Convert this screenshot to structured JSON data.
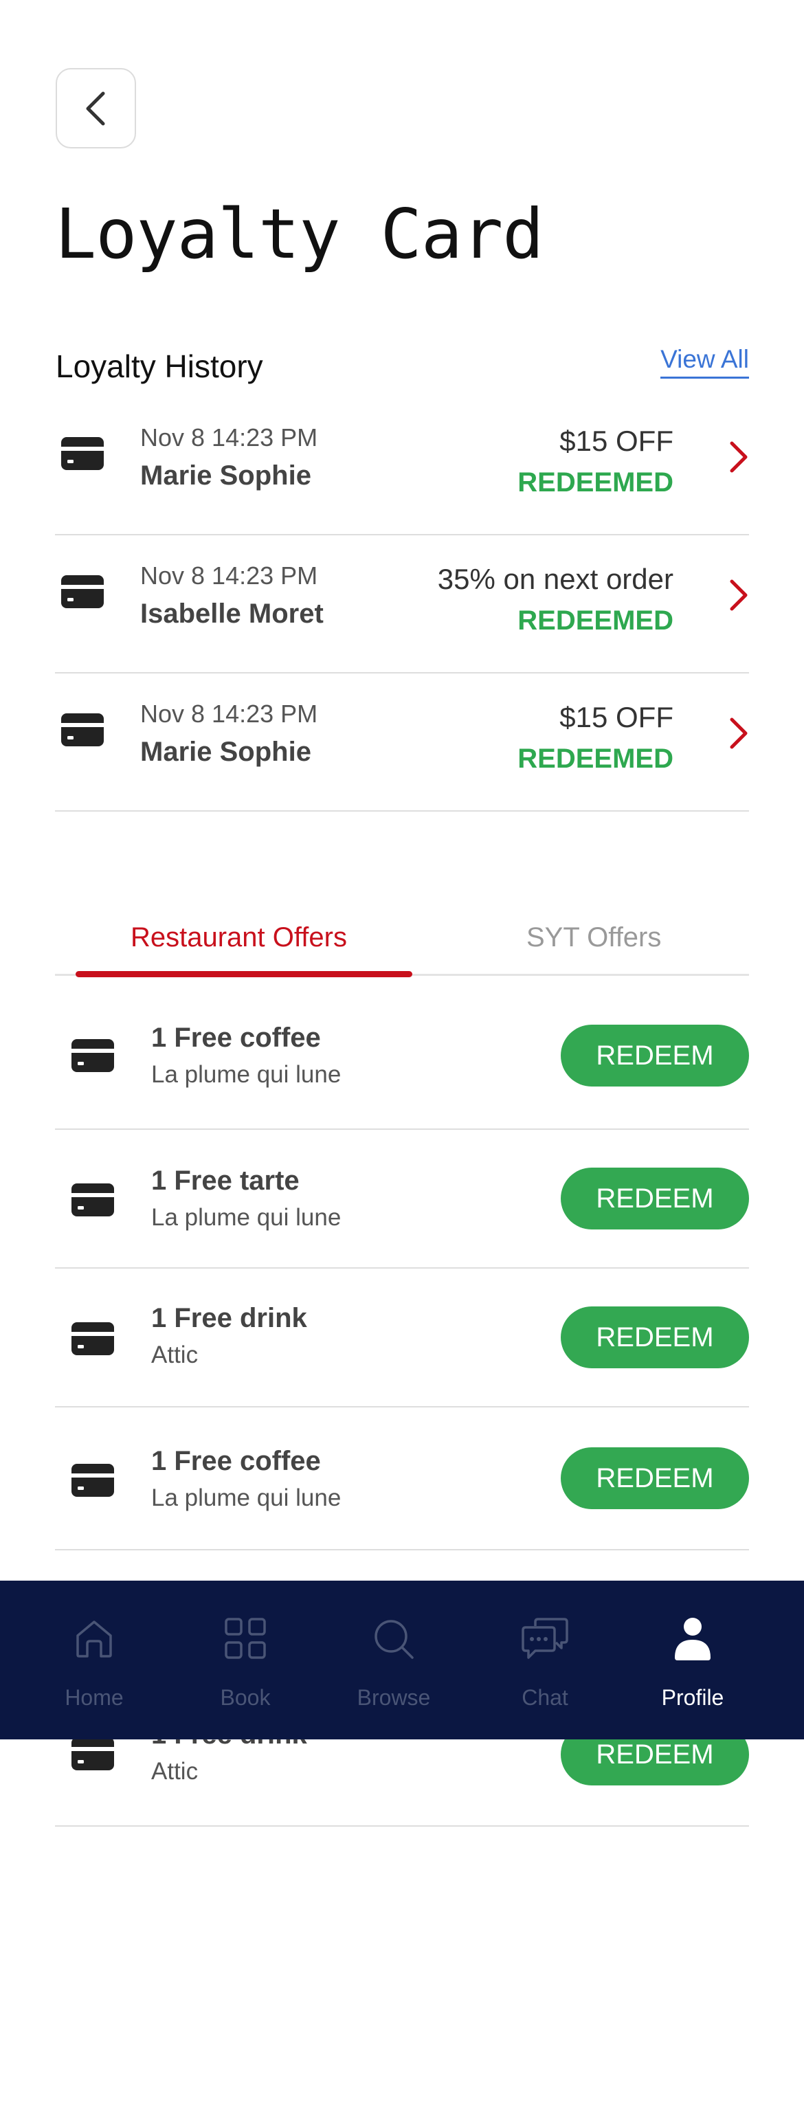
{
  "header": {
    "title": "Loyalty Card"
  },
  "history": {
    "title": "Loyalty History",
    "view_all": "View All",
    "items": [
      {
        "date": "Nov 8 14:23 PM",
        "name": "Marie Sophie",
        "amount": "$15 OFF",
        "status": "REDEEMED"
      },
      {
        "date": "Nov 8 14:23 PM",
        "name": "Isabelle Moret",
        "amount": "35% on next order",
        "status": "REDEEMED"
      },
      {
        "date": "Nov 8 14:23 PM",
        "name": "Marie Sophie",
        "amount": "$15 OFF",
        "status": "REDEEMED"
      }
    ]
  },
  "tabs": {
    "active": "Restaurant Offers",
    "inactive": "SYT Offers"
  },
  "offers": [
    {
      "name": "1 Free coffee",
      "place": "La plume qui lune",
      "button": "REDEEM"
    },
    {
      "name": "1 Free tarte",
      "place": "La plume qui lune",
      "button": "REDEEM"
    },
    {
      "name": "1 Free drink",
      "place": "Attic",
      "button": "REDEEM"
    },
    {
      "name": "1 Free coffee",
      "place": "La plume qui lune",
      "button": "REDEEM"
    },
    {
      "name": "1 Free drink",
      "place": "Attic",
      "button": "REDEEM"
    }
  ],
  "nav": {
    "home": "Home",
    "book": "Book",
    "browse": "Browse",
    "chat": "Chat",
    "profile": "Profile"
  },
  "colors": {
    "accent_red": "#c8101c",
    "green": "#33a852",
    "link_blue": "#3a74d6",
    "nav_bg": "#0b1742"
  },
  "icons": {
    "back": "chevron-left-icon",
    "card": "credit-card-icon",
    "row_arrow": "chevron-right-icon"
  }
}
